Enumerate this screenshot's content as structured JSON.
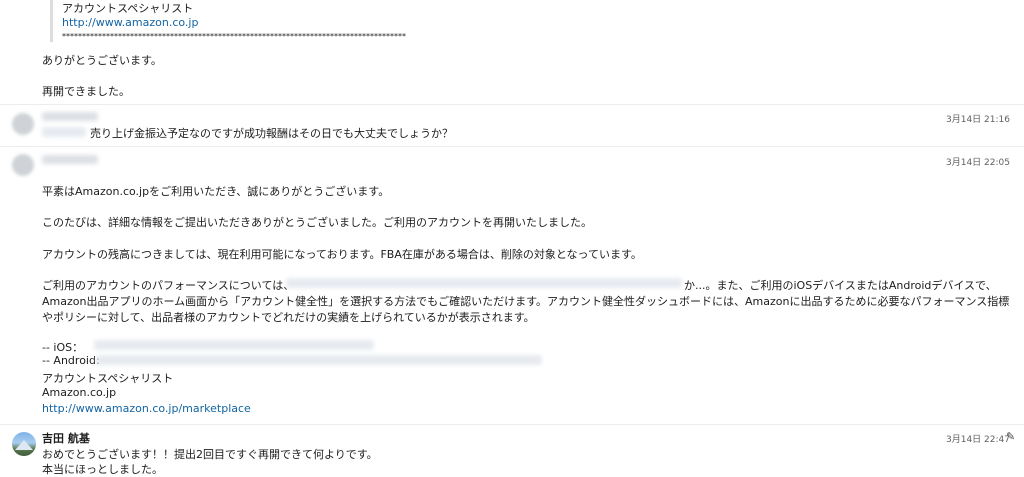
{
  "quote": {
    "signature_name": "アカウントスペシャリスト",
    "url": "http://www.amazon.co.jp",
    "stars": "**************************************************************************************"
  },
  "followup": {
    "line1": "ありがとうございます。",
    "line2": "再開できました。"
  },
  "msg1": {
    "timestamp": "3月14日 21:16",
    "text": "売り上げ金振込予定なのですが成功報酬はその日でも大丈夫でしょうか？"
  },
  "msg2": {
    "timestamp": "3月14日 22:05",
    "p1": "平素はAmazon.co.jpをご利用いただき、誠にありがとうございます。",
    "p2": "このたびは、詳細な情報をご提出いただきありがとうございました。ご利用のアカウントを再開いたしました。",
    "p3": "アカウントの残高につきましては、現在利用可能になっております。FBA在庫がある場合は、削除の対象となっています。",
    "p4_start": "ご利用のアカウントのパフォーマンスについては、",
    "p4_end": "か...。また、ご利用のiOSデバイスまたはAndroidデバイスで、",
    "p4_line2": "Amazon出品アプリのホーム画面から「アカウント健全性」を選択する方法でもご確認いただけます。アカウント健全性ダッシュボードには、Amazonに出品するために必要なパフォーマンス指標",
    "p4_line3": "やポリシーに対して、出品者様のアカウントでどれだけの実績を上げられているかが表示されます。",
    "ios_label": "-- iOS：",
    "android_label": "-- Android:",
    "sig1": "アカウントスペシャリスト",
    "sig2": "Amazon.co.jp",
    "sig3": "http://www.amazon.co.jp/marketplace"
  },
  "msg3": {
    "name": "吉田 航基",
    "timestamp": "3月14日 22:47",
    "line1": "おめでとうございます！！提出2回目ですぐ再開できて何よりです。",
    "line2": "本当にほっとしました。",
    "edit_icon": "pencil-icon"
  }
}
